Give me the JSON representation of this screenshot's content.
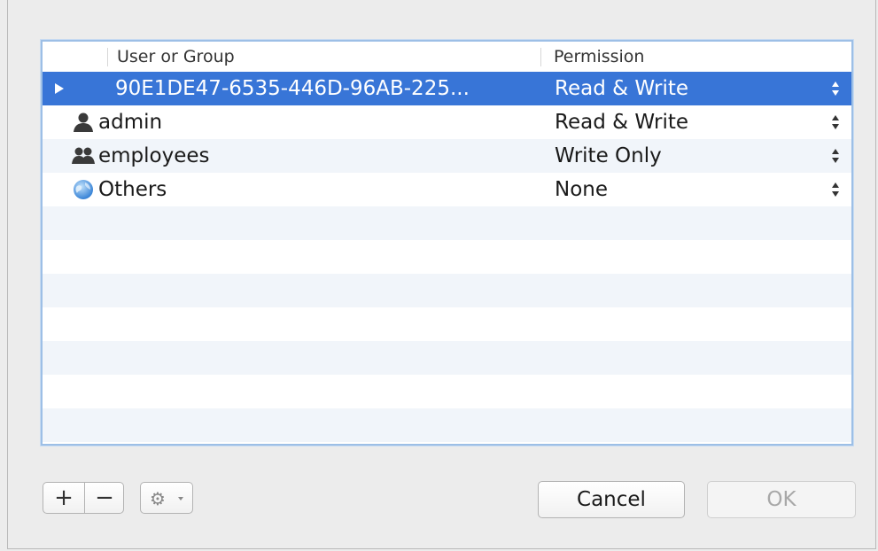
{
  "table": {
    "headers": {
      "user": "User or Group",
      "permission": "Permission"
    },
    "rows": [
      {
        "name": "90E1DE47-6535-446D-96AB-225...",
        "permission": "Read & Write",
        "icon": "disclosure-triangle-icon",
        "selected": true
      },
      {
        "name": "admin",
        "permission": "Read & Write",
        "icon": "user-icon"
      },
      {
        "name": "employees",
        "permission": "Write Only",
        "icon": "group-icon"
      },
      {
        "name": "Others",
        "permission": "None",
        "icon": "globe-icon"
      }
    ]
  },
  "toolbar": {
    "add_label": "+",
    "remove_label": "−",
    "action_icon": "gear-icon"
  },
  "buttons": {
    "cancel_label": "Cancel",
    "ok_label": "OK"
  },
  "colors": {
    "selection": "#3875d7",
    "alt_row": "#f1f5fa",
    "focus_ring": "#9dbfe6"
  }
}
